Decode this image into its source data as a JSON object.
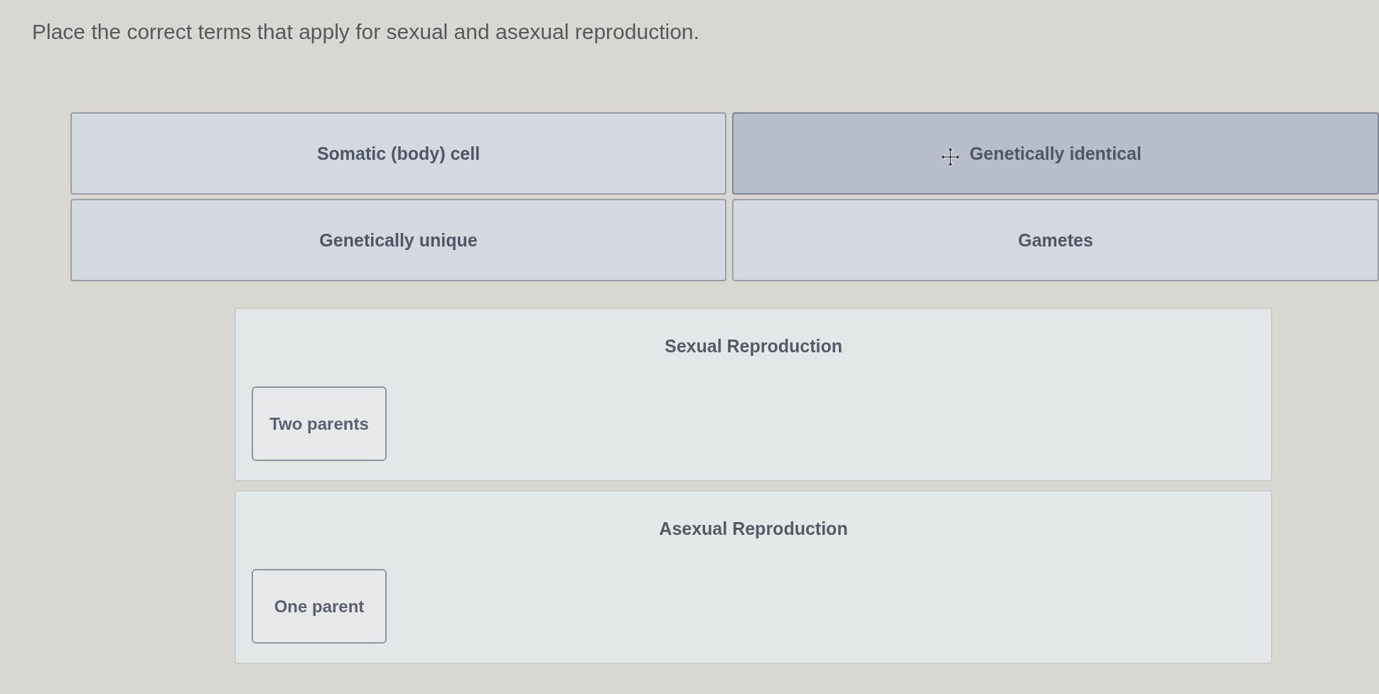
{
  "instruction": "Place the correct terms that apply for sexual and asexual reproduction.",
  "terms": [
    {
      "label": "Somatic (body) cell",
      "hovered": false
    },
    {
      "label": "Genetically identical",
      "hovered": true
    },
    {
      "label": "Genetically unique",
      "hovered": false
    },
    {
      "label": "Gametes",
      "hovered": false
    }
  ],
  "drop_zones": [
    {
      "title": "Sexual Reproduction",
      "placed": [
        "Two parents"
      ]
    },
    {
      "title": "Asexual Reproduction",
      "placed": [
        "One parent"
      ]
    }
  ]
}
